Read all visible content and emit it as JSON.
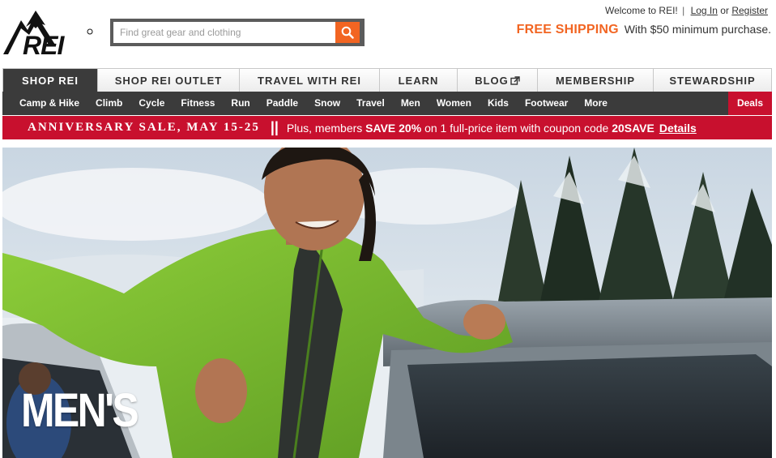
{
  "brand": {
    "logo_text": "REI"
  },
  "search": {
    "placeholder": "Find great gear and clothing",
    "icon": "search-icon"
  },
  "account": {
    "welcome": "Welcome to REI!",
    "separator": "|",
    "login": "Log In",
    "or": "or",
    "register": "Register"
  },
  "shipping": {
    "free_label": "FREE SHIPPING",
    "detail": "With $50 minimum purchase."
  },
  "main_nav": {
    "tabs": [
      {
        "label": "SHOP REI",
        "active": true
      },
      {
        "label": "SHOP REI OUTLET",
        "active": false
      },
      {
        "label": "TRAVEL WITH REI",
        "active": false
      },
      {
        "label": "LEARN",
        "active": false
      },
      {
        "label": "BLOG",
        "active": false,
        "icon": "external-link-icon"
      },
      {
        "label": "MEMBERSHIP",
        "active": false
      },
      {
        "label": "STEWARDSHIP",
        "active": false
      }
    ]
  },
  "sub_nav": {
    "items": [
      "Camp & Hike",
      "Climb",
      "Cycle",
      "Fitness",
      "Run",
      "Paddle",
      "Snow",
      "Travel",
      "Men",
      "Women",
      "Kids",
      "Footwear",
      "More"
    ],
    "deals": "Deals"
  },
  "promo": {
    "sale": "ANNIVERSARY SALE, MAY 15-25",
    "bars": "||",
    "msg_pre": "Plus, members",
    "msg_bold": "SAVE 20%",
    "msg_mid": "on 1 full-price item with coupon code",
    "code": "20SAVE",
    "details": "Details"
  },
  "hero": {
    "title": "MEN'S"
  },
  "colors": {
    "orange": "#f26522",
    "red": "#c8102e",
    "dark": "#3b3b3b",
    "jacket": "#7fc02f"
  }
}
